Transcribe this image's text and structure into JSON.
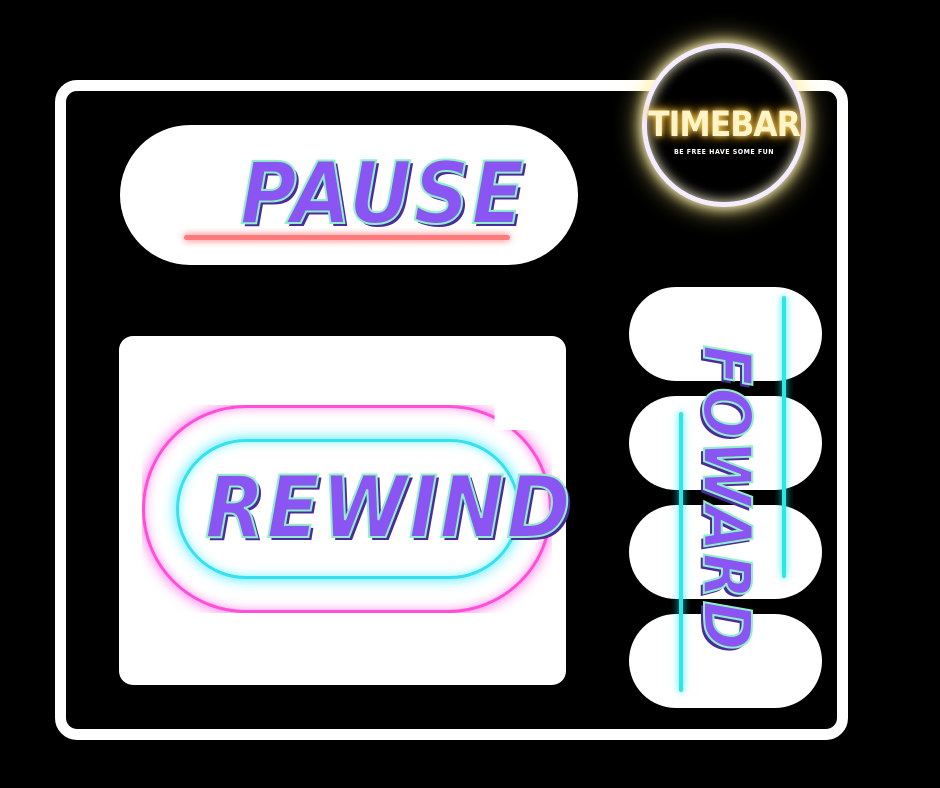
{
  "buttons": {
    "pause_label": "PAUSE",
    "rewind_label": "REWIND",
    "forward_label": "FOWARD"
  },
  "logo": {
    "title": "TIMEBAR",
    "tagline": "BE FREE HAVE SOME FUN"
  },
  "colors": {
    "background": "#000000",
    "frame": "#ffffff",
    "text_fill": "#8a55f2",
    "text_outline": "#8ff0c7",
    "pause_underline": "#ff7a7a",
    "rewind_outer_neon": "#ff4fd8",
    "rewind_inner_neon": "#35e0f0",
    "forward_neon": "#28e8e8",
    "logo_glow": "#ffe87a"
  }
}
